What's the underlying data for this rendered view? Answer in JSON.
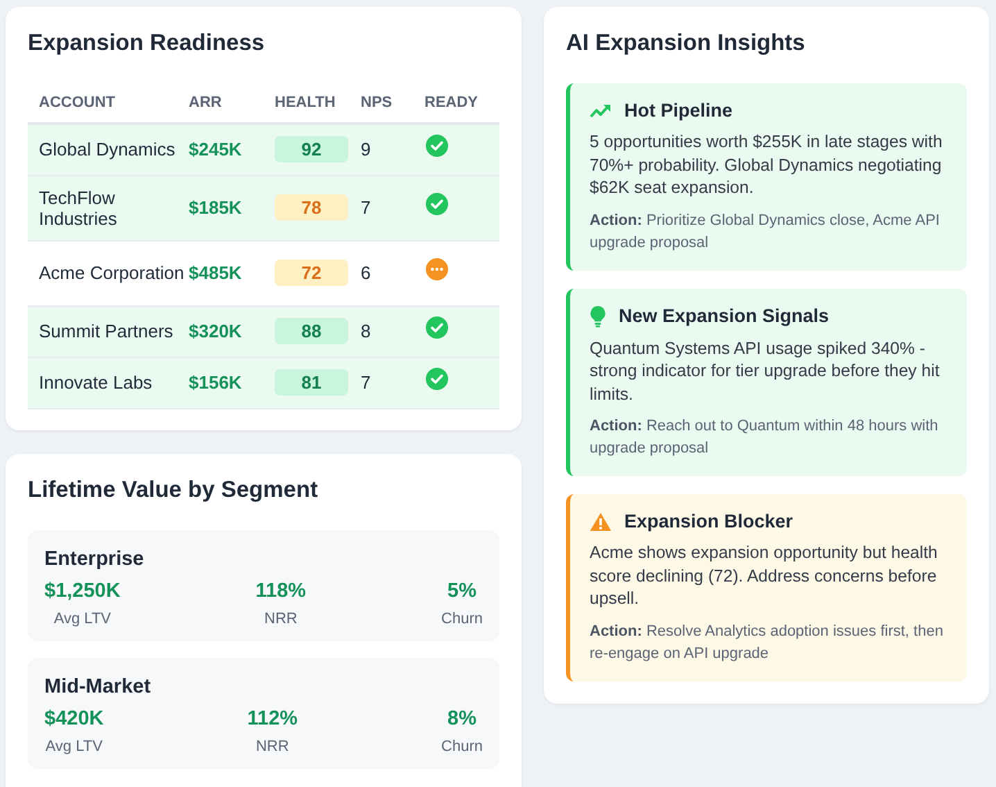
{
  "readiness": {
    "title": "Expansion Readiness",
    "columns": [
      "ACCOUNT",
      "ARR",
      "HEALTH",
      "NPS",
      "READY"
    ],
    "rows": [
      {
        "account": "Global Dynamics",
        "arr": "$245K",
        "health": "92",
        "health_warning": false,
        "nps": "9",
        "ready": true
      },
      {
        "account": "TechFlow Industries",
        "arr": "$185K",
        "health": "78",
        "health_warning": true,
        "nps": "7",
        "ready": true
      },
      {
        "account": "Acme Corporation",
        "arr": "$485K",
        "health": "72",
        "health_warning": true,
        "nps": "6",
        "ready": false
      },
      {
        "account": "Summit Partners",
        "arr": "$320K",
        "health": "88",
        "health_warning": false,
        "nps": "8",
        "ready": true
      },
      {
        "account": "Innovate Labs",
        "arr": "$156K",
        "health": "81",
        "health_warning": false,
        "nps": "7",
        "ready": true
      }
    ]
  },
  "ltv": {
    "title": "Lifetime Value by Segment",
    "segments": [
      {
        "name": "Enterprise",
        "metrics": [
          {
            "value": "$1,250K",
            "label": "Avg LTV"
          },
          {
            "value": "118%",
            "label": "NRR"
          },
          {
            "value": "5%",
            "label": "Churn"
          }
        ]
      },
      {
        "name": "Mid-Market",
        "metrics": [
          {
            "value": "$420K",
            "label": "Avg LTV"
          },
          {
            "value": "112%",
            "label": "NRR"
          },
          {
            "value": "8%",
            "label": "Churn"
          }
        ]
      }
    ]
  },
  "insights": {
    "title": "AI Expansion Insights",
    "items": [
      {
        "kind": "trend",
        "title": "Hot Pipeline",
        "body": "5 opportunities worth $255K in late stages with 70%+ probability. Global Dynamics negotiating $62K seat expansion.",
        "action": "**Action:** Prioritize Global Dynamics close, Acme API upgrade proposal"
      },
      {
        "kind": "signal",
        "title": "New Expansion Signals",
        "body": "Quantum Systems API usage spiked 340% - strong indicator for tier upgrade before they hit limits.",
        "action": "**Action:** Reach out to Quantum within 48 hours with upgrade proposal"
      },
      {
        "kind": "blocker",
        "title": "Expansion Blocker",
        "body": "Acme shows expansion opportunity but health score declining (72). Address concerns before upsell.",
        "action": "**Action:** Resolve Analytics adoption issues first, then re-engage on API upgrade"
      }
    ]
  }
}
